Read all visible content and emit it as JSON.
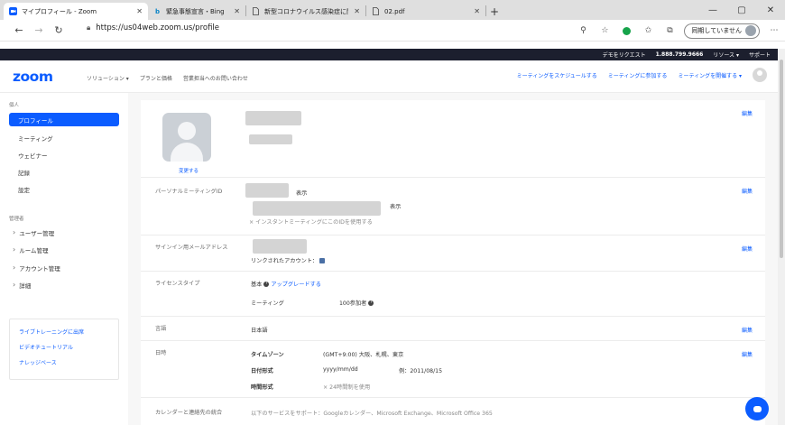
{
  "browser": {
    "tabs": [
      {
        "title": "マイプロフィール - Zoom",
        "icon": "video-camera-icon",
        "active": true
      },
      {
        "title": "緊急事態宣言・Bing",
        "icon": "bing-icon",
        "active": false
      },
      {
        "title": "新型コロナウイルス感染症に関する...",
        "icon": "page-icon",
        "active": false
      },
      {
        "title": "02.pdf",
        "icon": "page-icon",
        "active": false
      }
    ],
    "url": "https://us04web.zoom.us/profile",
    "sync_label": "同期していません"
  },
  "topbar": {
    "links": [
      "デモをリクエスト",
      "1.888.799.9666",
      "リソース ▾",
      "サポート"
    ]
  },
  "nav": {
    "logo": "zoom",
    "links": [
      "ソリューション ▾",
      "プランと価格",
      "営業担当へのお問い合わせ"
    ],
    "right_links": [
      "ミーティングをスケジュールする",
      "ミーティングに参加する",
      "ミーティングを開催する ▾"
    ]
  },
  "sidebar": {
    "section_personal": "個人",
    "personal_items": [
      "プロフィール",
      "ミーティング",
      "ウェビナー",
      "記録",
      "設定"
    ],
    "section_admin": "管理者",
    "admin_items": [
      "ユーザー管理",
      "ルーム管理",
      "アカウント管理",
      "詳細"
    ],
    "help_links": [
      "ライブトレーニングに出席",
      "ビデオチュートリアル",
      "ナレッジベース"
    ]
  },
  "profile": {
    "change_label": "変更する",
    "edit_label": "編集",
    "show_label": "表示",
    "pmi_label": "パーソナルミーティングID",
    "pmi_note": "× インスタントミーティングにこのIDを使用する",
    "email_label": "サインイン用メールアドレス",
    "linked_accounts": "リンクされたアカウント：",
    "license_label": "ライセンスタイプ",
    "license_value": "基本",
    "upgrade_link": "アップグレードする",
    "meeting_label": "ミーティング",
    "meeting_value": "100参加者",
    "language_label": "言語",
    "language_value": "日本語",
    "datetime_label": "日時",
    "timezone_label": "タイムゾーン",
    "timezone_value": "(GMT+9:00) 大阪、札幌、東京",
    "date_format_label": "日付形式",
    "date_format_value": "yyyy/mm/dd",
    "date_example": "例：2011/08/15",
    "time_format_label": "時間形式",
    "time_format_value": "× 24時間制を使用",
    "calendar_label": "カレンダーと連絡先の統合",
    "calendar_value": "以下のサービスをサポート：Googleカレンダー、Microsoft Exchange、Microsoft Office 365"
  }
}
